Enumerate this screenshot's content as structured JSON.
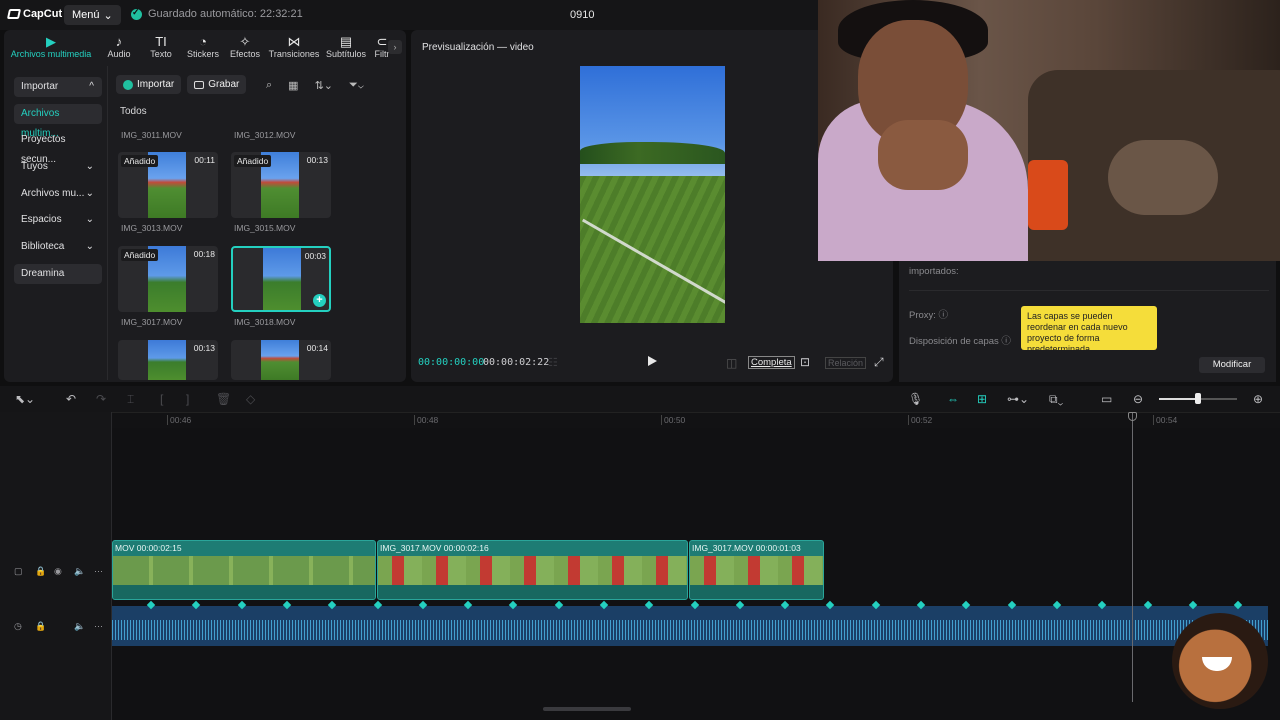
{
  "app": {
    "logo": "CapCut",
    "menu_label": "Menú",
    "autosave": "Guardado automático: 22:32:21",
    "project_title": "0910"
  },
  "tool_tabs": [
    {
      "label": "Archivos multimedia",
      "icon": "media-icon",
      "glyph": "▶"
    },
    {
      "label": "Audio",
      "icon": "audio-icon",
      "glyph": "♪"
    },
    {
      "label": "Texto",
      "icon": "text-icon",
      "glyph": "TI"
    },
    {
      "label": "Stickers",
      "icon": "sticker-icon",
      "glyph": "◔"
    },
    {
      "label": "Efectos",
      "icon": "effects-icon",
      "glyph": "✧"
    },
    {
      "label": "Transiciones",
      "icon": "transitions-icon",
      "glyph": "⋈"
    },
    {
      "label": "Subtítulos",
      "icon": "subtitles-icon",
      "glyph": "▤"
    },
    {
      "label": "Filtr",
      "icon": "filters-icon",
      "glyph": "⊂"
    }
  ],
  "sidenav": [
    {
      "label": "Importar",
      "caret": "^"
    },
    {
      "label": "Archivos multim...",
      "caret": ""
    },
    {
      "label": "Proyectos secun...",
      "caret": ""
    },
    {
      "label": "Tuyos",
      "caret": "⌄"
    },
    {
      "label": "Archivos mu...",
      "caret": "⌄"
    },
    {
      "label": "Espacios",
      "caret": "⌄"
    },
    {
      "label": "Biblioteca",
      "caret": "⌄"
    },
    {
      "label": "Dreamina",
      "caret": ""
    }
  ],
  "import_bar": {
    "import_label": "Importar",
    "record_label": "Grabar",
    "filter_label": "Todos"
  },
  "media": {
    "top_names": [
      "IMG_3011.MOV",
      "IMG_3012.MOV"
    ],
    "clips": [
      {
        "name": "IMG_3013.MOV",
        "tag": "Añadido",
        "duration": "00:11"
      },
      {
        "name": "IMG_3015.MOV",
        "tag": "Añadido",
        "duration": "00:13"
      },
      {
        "name": "IMG_3017.MOV",
        "tag": "Añadido",
        "duration": "00:18"
      },
      {
        "name": "IMG_3018.MOV",
        "tag": "",
        "duration": "00:03"
      },
      {
        "name": "",
        "tag": "",
        "duration": "00:13"
      },
      {
        "name": "",
        "tag": "",
        "duration": "00:14"
      }
    ]
  },
  "preview": {
    "title": "Previsualización — video",
    "current_time": "00:00:00:00",
    "total_time": "00:00:02:22",
    "ratio_full": "Completa",
    "ratio_label": "Relación"
  },
  "details": {
    "imported_label": "importados:",
    "proxy_label": "Proxy: ⓘ",
    "layers_label": "Disposición de capas ⓘ",
    "tooltip": "Las capas se pueden reordenar en cada nuevo proyecto de forma predeterminada.",
    "modify_label": "Modificar"
  },
  "timeline": {
    "ruler": [
      "00:46",
      "00:48",
      "00:50",
      "00:52",
      "00:54"
    ],
    "clips": [
      {
        "label": "MOV  00:00:02:15"
      },
      {
        "label": "IMG_3017.MOV  00:00:02:16"
      },
      {
        "label": "IMG_3017.MOV  00:00:01:03"
      }
    ]
  }
}
